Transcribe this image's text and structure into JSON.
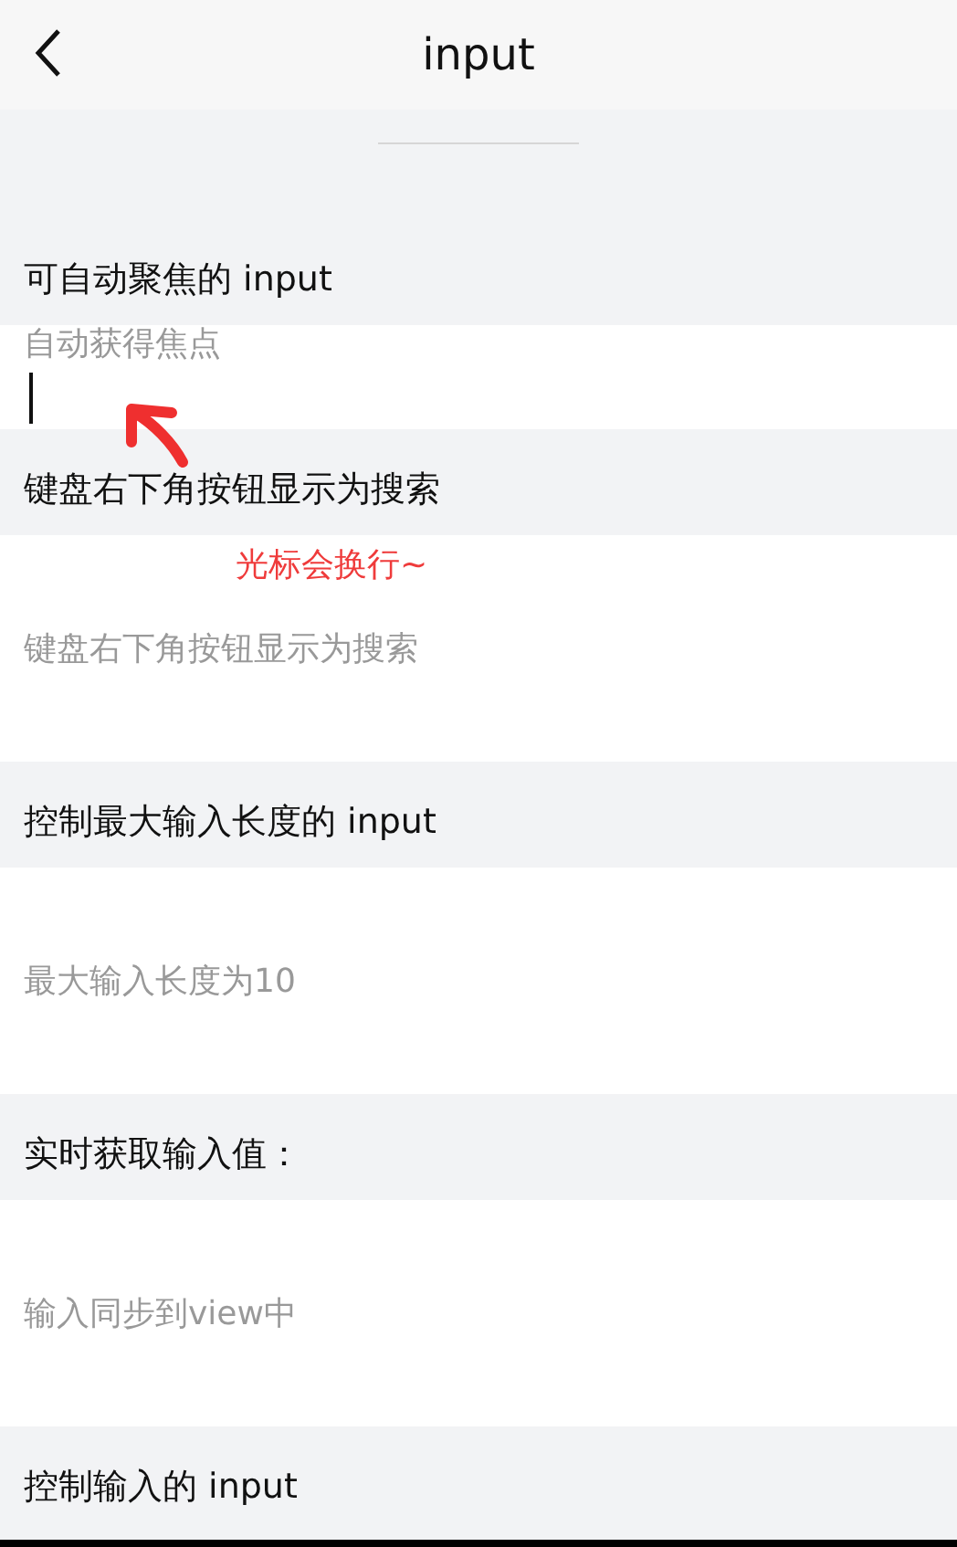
{
  "nav": {
    "title": "input"
  },
  "sections": [
    {
      "title": "可自动聚焦的 input",
      "placeholder": "自动获得焦点",
      "focused": true
    },
    {
      "title": "键盘右下角按钮显示为搜索",
      "placeholder": "键盘右下角按钮显示为搜索",
      "focused": false
    },
    {
      "title": "控制最大输入长度的 input",
      "placeholder": "最大输入长度为10",
      "focused": false
    },
    {
      "title": "实时获取输入值：",
      "placeholder": "输入同步到view中",
      "focused": false
    },
    {
      "title": "控制输入的 input"
    }
  ],
  "annotation": {
    "text": "光标会换行~"
  }
}
